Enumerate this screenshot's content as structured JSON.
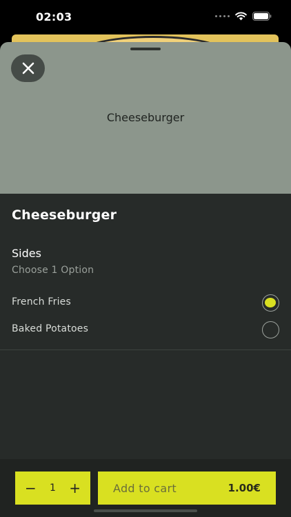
{
  "status_bar": {
    "time": "02:03"
  },
  "sheet": {
    "hero_title": "Cheeseburger",
    "product_title": "Cheeseburger"
  },
  "option_group": {
    "title": "Sides",
    "subtitle": "Choose 1 Option",
    "options": [
      {
        "label": "French Fries",
        "selected": true
      },
      {
        "label": "Baked Potatoes",
        "selected": false
      }
    ]
  },
  "footer": {
    "quantity": "1",
    "minus_label": "−",
    "plus_label": "+",
    "add_to_cart_label": "Add to cart",
    "price": "1.00€"
  },
  "colors": {
    "accent": "#d9e021",
    "hero_bg": "#8c968c",
    "sheet_bg": "#272b29"
  }
}
